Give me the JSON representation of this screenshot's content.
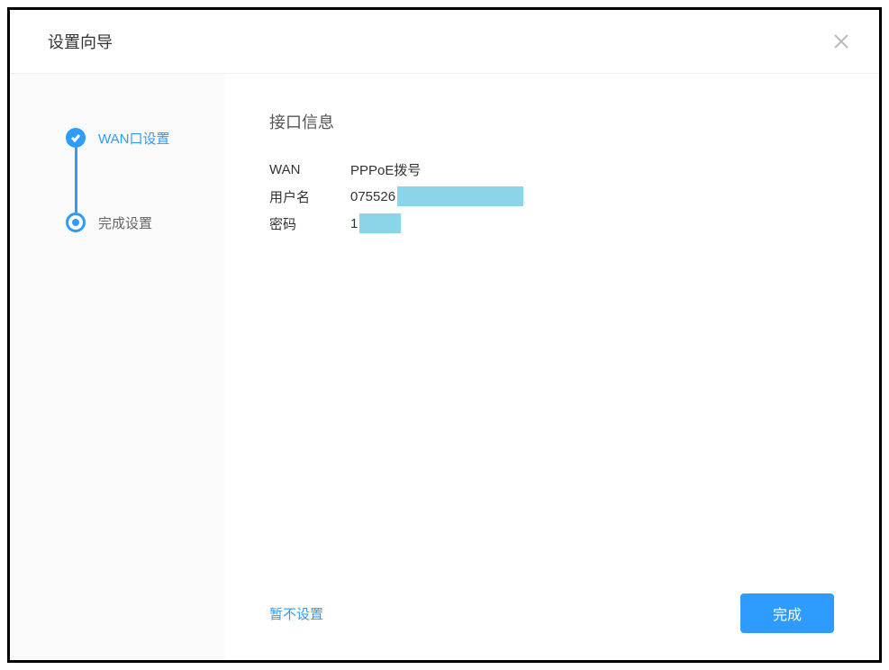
{
  "header": {
    "title": "设置向导"
  },
  "sidebar": {
    "steps": [
      {
        "label": "WAN口设置",
        "status": "checked"
      },
      {
        "label": "完成设置",
        "status": "current"
      }
    ]
  },
  "main": {
    "section_title": "接口信息",
    "rows": [
      {
        "label": "WAN",
        "value": "PPPoE拨号"
      },
      {
        "label": "用户名",
        "value_prefix": "075526"
      },
      {
        "label": "密码",
        "value_prefix": "1"
      }
    ]
  },
  "footer": {
    "skip_label": "暂不设置",
    "finish_label": "完成"
  }
}
